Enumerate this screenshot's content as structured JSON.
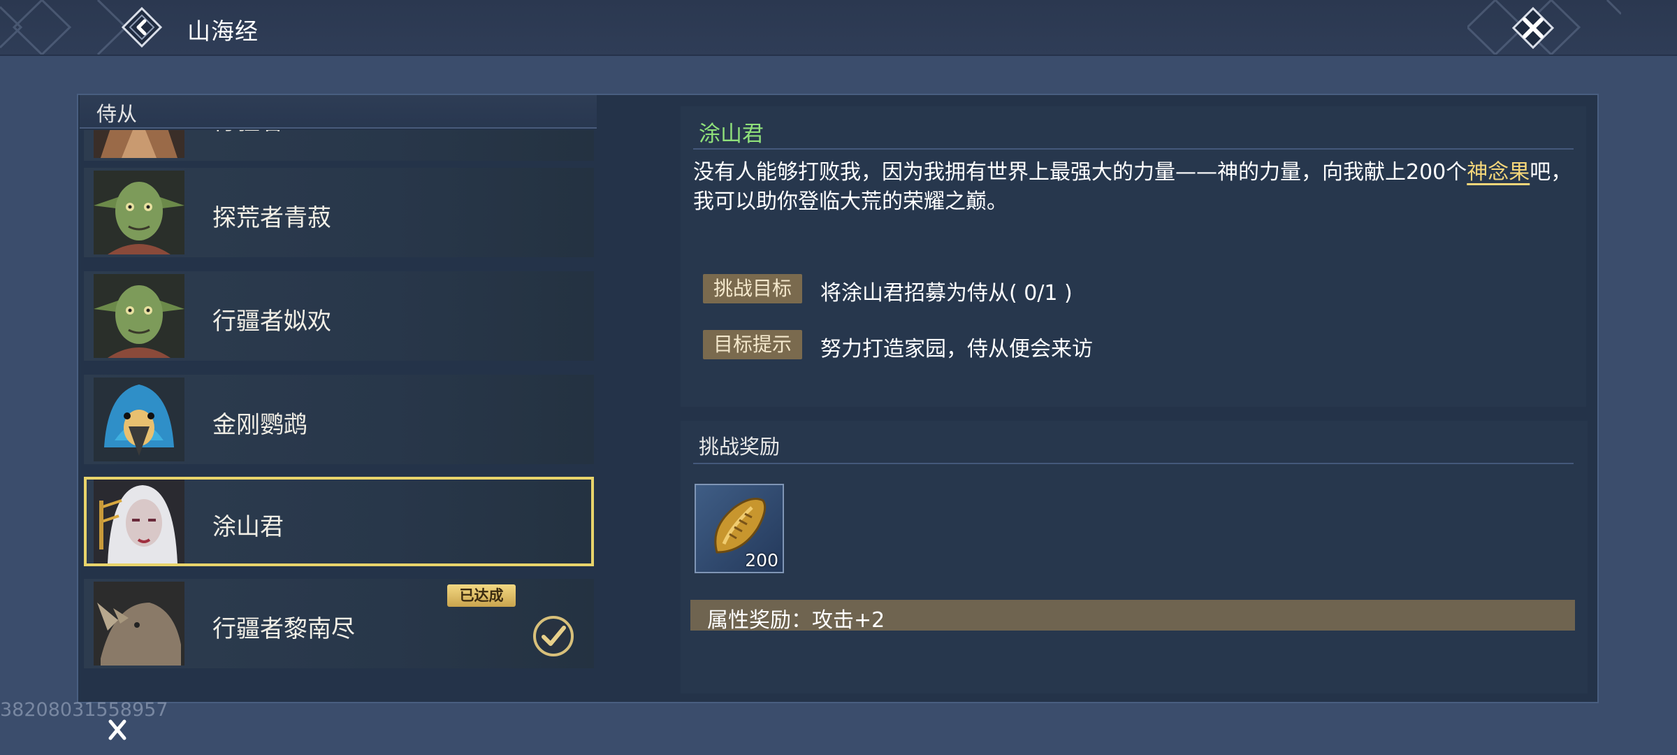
{
  "header": {
    "title": "山海经",
    "back_icon": "back-arrow-icon",
    "close_icon": "close-x-icon"
  },
  "left_panel": {
    "title": "侍从",
    "items": [
      {
        "name": "行疆者",
        "portrait": "brown-beast-portrait"
      },
      {
        "name": "探荒者青菽",
        "portrait": "green-goblin-portrait"
      },
      {
        "name": "行疆者姒欢",
        "portrait": "green-goblin-portrait"
      },
      {
        "name": "金刚鹦鹉",
        "portrait": "blue-parrot-portrait"
      },
      {
        "name": "涂山君",
        "portrait": "white-haired-woman-portrait",
        "selected": true
      },
      {
        "name": "行疆者黎南尽",
        "portrait": "rhino-portrait",
        "badge": "已达成",
        "completed": true
      }
    ]
  },
  "detail": {
    "name": "涂山君",
    "desc_part1": "没有人能够打败我，因为我拥有世界上最强大的力量——神的力量，向我献上200个",
    "desc_highlight": "神念果",
    "desc_part2": "吧，我可以助你登临大荒的荣耀之巅。",
    "goal_tag": "挑战目标",
    "goal_value": "将涂山君招募为侍从( 0/1 )",
    "hint_tag": "目标提示",
    "hint_value": "努力打造家园，侍从便会来访"
  },
  "reward": {
    "title": "挑战奖励",
    "item_icon": "seed-fruit-icon",
    "item_qty": "200",
    "attr_text": "属性奖励：攻击+2"
  },
  "watermark": "38208031558957",
  "colors": {
    "name_green": "#8fe07a",
    "highlight_gold": "#f4d67a",
    "selected_border": "#e8d46b",
    "tag_bg": "#7a6a4e"
  }
}
